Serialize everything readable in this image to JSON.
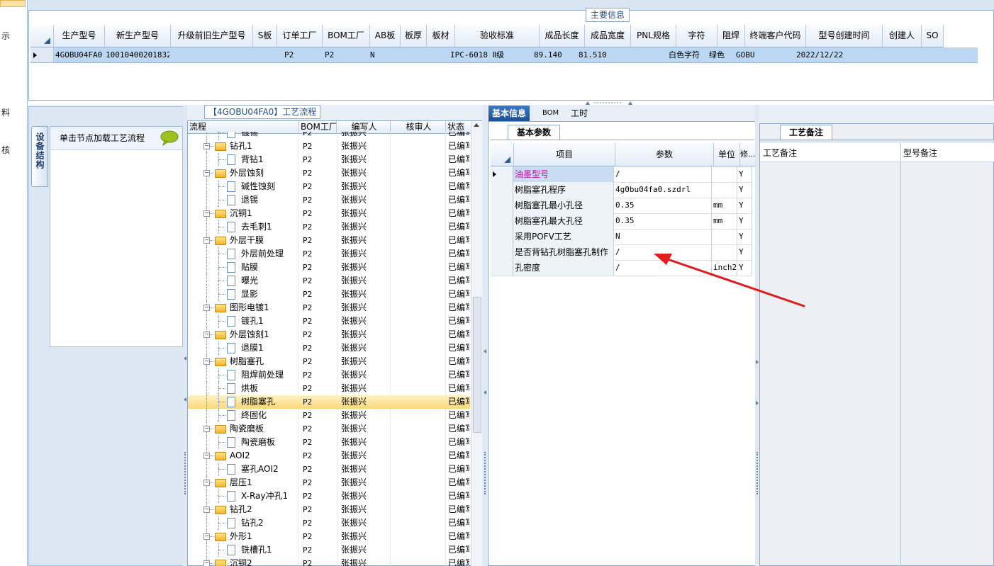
{
  "left_strip": {
    "labels": [
      "示",
      "料",
      "核"
    ]
  },
  "main_info": {
    "caption": "主要信息",
    "columns": [
      "生产型号",
      "新生产型号",
      "升级前旧生产型号",
      "S板",
      "订单工厂",
      "BOM工厂",
      "AB板",
      "板厚",
      "板材",
      "验收标准",
      "成品长度",
      "成品宽度",
      "PNL规格",
      "字符",
      "阻焊",
      "终端客户代码",
      "型号创建时间",
      "创建人",
      "SO"
    ],
    "row": [
      "4GOBU04FA0",
      "10010400201832",
      "",
      "",
      "P2",
      "P2",
      "N",
      "",
      "",
      "IPC-6018 Ⅱ级",
      "89.140",
      "81.510",
      "",
      "白色字符",
      "绿色",
      "GOBU",
      "2022/12/22",
      "",
      ""
    ]
  },
  "equipment": {
    "tab_label": "设备结构",
    "hint": "单击节点加载工艺流程"
  },
  "process_tree": {
    "caption": "【4GOBU04FA0】工艺流程",
    "columns": [
      "流程",
      "BOM工厂",
      "编写人",
      "核审人",
      "状态"
    ],
    "rows": [
      {
        "level": 2,
        "name": "镀锡",
        "bom": "P2",
        "author": "张振兴",
        "status": "已编写"
      },
      {
        "level": 1,
        "name": "钻孔1",
        "bom": "P2",
        "author": "张振兴",
        "status": "已编写"
      },
      {
        "level": 2,
        "name": "背钻1",
        "bom": "P2",
        "author": "张振兴",
        "status": "已编写"
      },
      {
        "level": 1,
        "name": "外层蚀刻",
        "bom": "P2",
        "author": "张振兴",
        "status": "已编写"
      },
      {
        "level": 2,
        "name": "碱性蚀刻",
        "bom": "P2",
        "author": "张振兴",
        "status": "已编写"
      },
      {
        "level": 2,
        "name": "退锡",
        "bom": "P2",
        "author": "张振兴",
        "status": "已编写"
      },
      {
        "level": 1,
        "name": "沉铜1",
        "bom": "P2",
        "author": "张振兴",
        "status": "已编写"
      },
      {
        "level": 2,
        "name": "去毛刺1",
        "bom": "P2",
        "author": "张振兴",
        "status": "已编写"
      },
      {
        "level": 1,
        "name": "外层干膜",
        "bom": "P2",
        "author": "张振兴",
        "status": "已编写"
      },
      {
        "level": 2,
        "name": "外层前处理",
        "bom": "P2",
        "author": "张振兴",
        "status": "已编写"
      },
      {
        "level": 2,
        "name": "贴膜",
        "bom": "P2",
        "author": "张振兴",
        "status": "已编写"
      },
      {
        "level": 2,
        "name": "曝光",
        "bom": "P2",
        "author": "张振兴",
        "status": "已编写"
      },
      {
        "level": 2,
        "name": "显影",
        "bom": "P2",
        "author": "张振兴",
        "status": "已编写"
      },
      {
        "level": 1,
        "name": "图形电镀1",
        "bom": "P2",
        "author": "张振兴",
        "status": "已编写"
      },
      {
        "level": 2,
        "name": "镀孔1",
        "bom": "P2",
        "author": "张振兴",
        "status": "已编写"
      },
      {
        "level": 1,
        "name": "外层蚀刻1",
        "bom": "P2",
        "author": "张振兴",
        "status": "已编写"
      },
      {
        "level": 2,
        "name": "退膜1",
        "bom": "P2",
        "author": "张振兴",
        "status": "已编写"
      },
      {
        "level": 1,
        "name": "树脂塞孔",
        "bom": "P2",
        "author": "张振兴",
        "status": "已编写"
      },
      {
        "level": 2,
        "name": "阻焊前处理",
        "bom": "P2",
        "author": "张振兴",
        "status": "已编写"
      },
      {
        "level": 2,
        "name": "烘板",
        "bom": "P2",
        "author": "张振兴",
        "status": "已编写"
      },
      {
        "level": 2,
        "name": "树脂塞孔",
        "bom": "P2",
        "author": "张振兴",
        "status": "已编写",
        "selected": true
      },
      {
        "level": 2,
        "name": "终固化",
        "bom": "P2",
        "author": "张振兴",
        "status": "已编写"
      },
      {
        "level": 1,
        "name": "陶瓷磨板",
        "bom": "P2",
        "author": "张振兴",
        "status": "已编写"
      },
      {
        "level": 2,
        "name": "陶瓷磨板",
        "bom": "P2",
        "author": "张振兴",
        "status": "已编写"
      },
      {
        "level": 1,
        "name": "AOI2",
        "bom": "P2",
        "author": "张振兴",
        "status": "已编写"
      },
      {
        "level": 2,
        "name": "塞孔AOI2",
        "bom": "P2",
        "author": "张振兴",
        "status": "已编写"
      },
      {
        "level": 1,
        "name": "层压1",
        "bom": "P2",
        "author": "张振兴",
        "status": "已编写"
      },
      {
        "level": 2,
        "name": "X-Ray冲孔1",
        "bom": "P2",
        "author": "张振兴",
        "status": "已编写"
      },
      {
        "level": 1,
        "name": "钻孔2",
        "bom": "P2",
        "author": "张振兴",
        "status": "已编写"
      },
      {
        "level": 2,
        "name": "钻孔2",
        "bom": "P2",
        "author": "张振兴",
        "status": "已编写"
      },
      {
        "level": 1,
        "name": "外形1",
        "bom": "P2",
        "author": "张振兴",
        "status": "已编写"
      },
      {
        "level": 2,
        "name": "铣槽孔1",
        "bom": "P2",
        "author": "张振兴",
        "status": "已编写"
      },
      {
        "level": 1,
        "name": "沉铜2",
        "bom": "P2",
        "author": "张振兴",
        "status": "已编写"
      }
    ]
  },
  "info_tabs": [
    "基本信息",
    "BOM",
    "工时"
  ],
  "basic_params": {
    "tab": "基本参数",
    "columns": [
      "项目",
      "参数",
      "单位",
      "修..."
    ],
    "rows": [
      {
        "item": "油墨型号",
        "value": "/",
        "unit": "",
        "flag": "Y",
        "highlight": true
      },
      {
        "item": "树脂塞孔程序",
        "value": "4g0bu04fa0.szdrl",
        "unit": "",
        "flag": "Y"
      },
      {
        "item": "树脂塞孔最小孔径",
        "value": "0.35",
        "unit": "mm",
        "flag": "Y"
      },
      {
        "item": "树脂塞孔最大孔径",
        "value": "0.35",
        "unit": "mm",
        "flag": "Y"
      },
      {
        "item": "采用POFV工艺",
        "value": "N",
        "unit": "",
        "flag": "Y"
      },
      {
        "item": "是否背钻孔树脂塞孔制作",
        "value": "/",
        "unit": "",
        "flag": "Y"
      },
      {
        "item": "孔密度",
        "value": "/",
        "unit": "inch2",
        "flag": "Y"
      }
    ]
  },
  "remarks": {
    "tab": "工艺备注",
    "process_remark": "工艺备注",
    "model_remark": "型号备注"
  },
  "colors": {
    "accent": "#1b4f95",
    "selection_row": "#bcd7f1",
    "highlight_text": "#c0189a",
    "annotation_arrow": "#e31b1b"
  }
}
